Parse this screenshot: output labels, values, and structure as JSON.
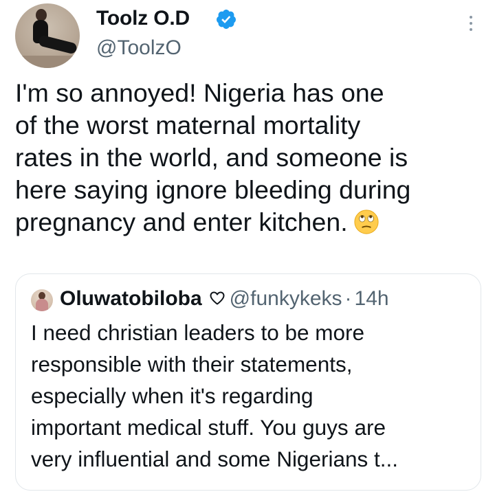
{
  "author": {
    "display_name": "Toolz O.D",
    "handle": "@ToolzO",
    "verified": true,
    "verified_color": "#1d9bf0"
  },
  "tweet": {
    "lines": [
      "I'm so annoyed! Nigeria has one",
      "of the worst maternal mortality",
      "rates in the world, and someone is",
      "here saying ignore bleeding during",
      "pregnancy and enter kitchen."
    ],
    "emoji": "face-with-rolling-eyes-icon"
  },
  "quote": {
    "display_name": "Oluwatobiloba",
    "name_icon": "heart-outline-icon",
    "handle": "@funkykeks",
    "separator": "·",
    "time": "14h",
    "lines": [
      "I need christian leaders to be more",
      "responsible with their statements,",
      "especially when it's regarding",
      "important medical stuff. You guys are",
      "very influential and some Nigerians t..."
    ]
  },
  "colors": {
    "text_primary": "#0f1419",
    "text_secondary": "#536471",
    "border": "#e1e6ea"
  }
}
